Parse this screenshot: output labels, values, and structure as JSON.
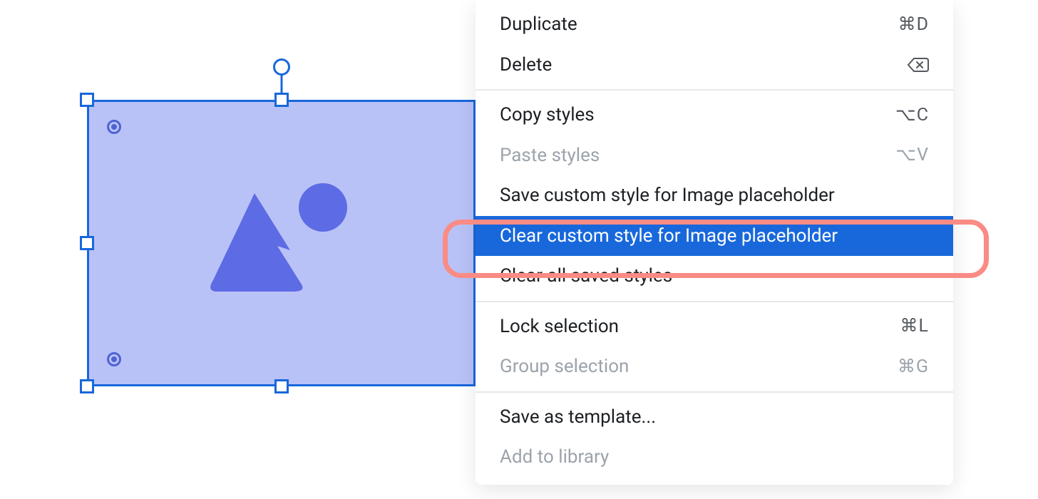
{
  "canvas": {
    "selected_element": "Image placeholder"
  },
  "menu": {
    "items": [
      {
        "id": "duplicate",
        "label": "Duplicate",
        "shortcut": "⌘D",
        "disabled": false,
        "selected": false,
        "divider_after": false
      },
      {
        "id": "delete",
        "label": "Delete",
        "shortcut": "del-key",
        "disabled": false,
        "selected": false,
        "divider_after": true
      },
      {
        "id": "copy-styles",
        "label": "Copy styles",
        "shortcut": "⌥C",
        "disabled": false,
        "selected": false,
        "divider_after": false
      },
      {
        "id": "paste-styles",
        "label": "Paste styles",
        "shortcut": "⌥V",
        "disabled": true,
        "selected": false,
        "divider_after": false
      },
      {
        "id": "save-custom-style",
        "label": "Save custom style for Image placeholder",
        "shortcut": "",
        "disabled": false,
        "selected": false,
        "divider_after": false
      },
      {
        "id": "clear-custom-style",
        "label": "Clear custom style for Image placeholder",
        "shortcut": "",
        "disabled": false,
        "selected": true,
        "divider_after": false
      },
      {
        "id": "clear-all-styles",
        "label": "Clear all saved styles",
        "shortcut": "",
        "disabled": false,
        "selected": false,
        "divider_after": true
      },
      {
        "id": "lock-selection",
        "label": "Lock selection",
        "shortcut": "⌘L",
        "disabled": false,
        "selected": false,
        "divider_after": false
      },
      {
        "id": "group-selection",
        "label": "Group selection",
        "shortcut": "⌘G",
        "disabled": true,
        "selected": false,
        "divider_after": true
      },
      {
        "id": "save-as-template",
        "label": "Save as template...",
        "shortcut": "",
        "disabled": false,
        "selected": false,
        "divider_after": false
      },
      {
        "id": "add-to-library",
        "label": "Add to library",
        "shortcut": "",
        "disabled": true,
        "selected": false,
        "divider_after": false
      }
    ]
  },
  "callout": {
    "target_item_id": "clear-custom-style"
  }
}
